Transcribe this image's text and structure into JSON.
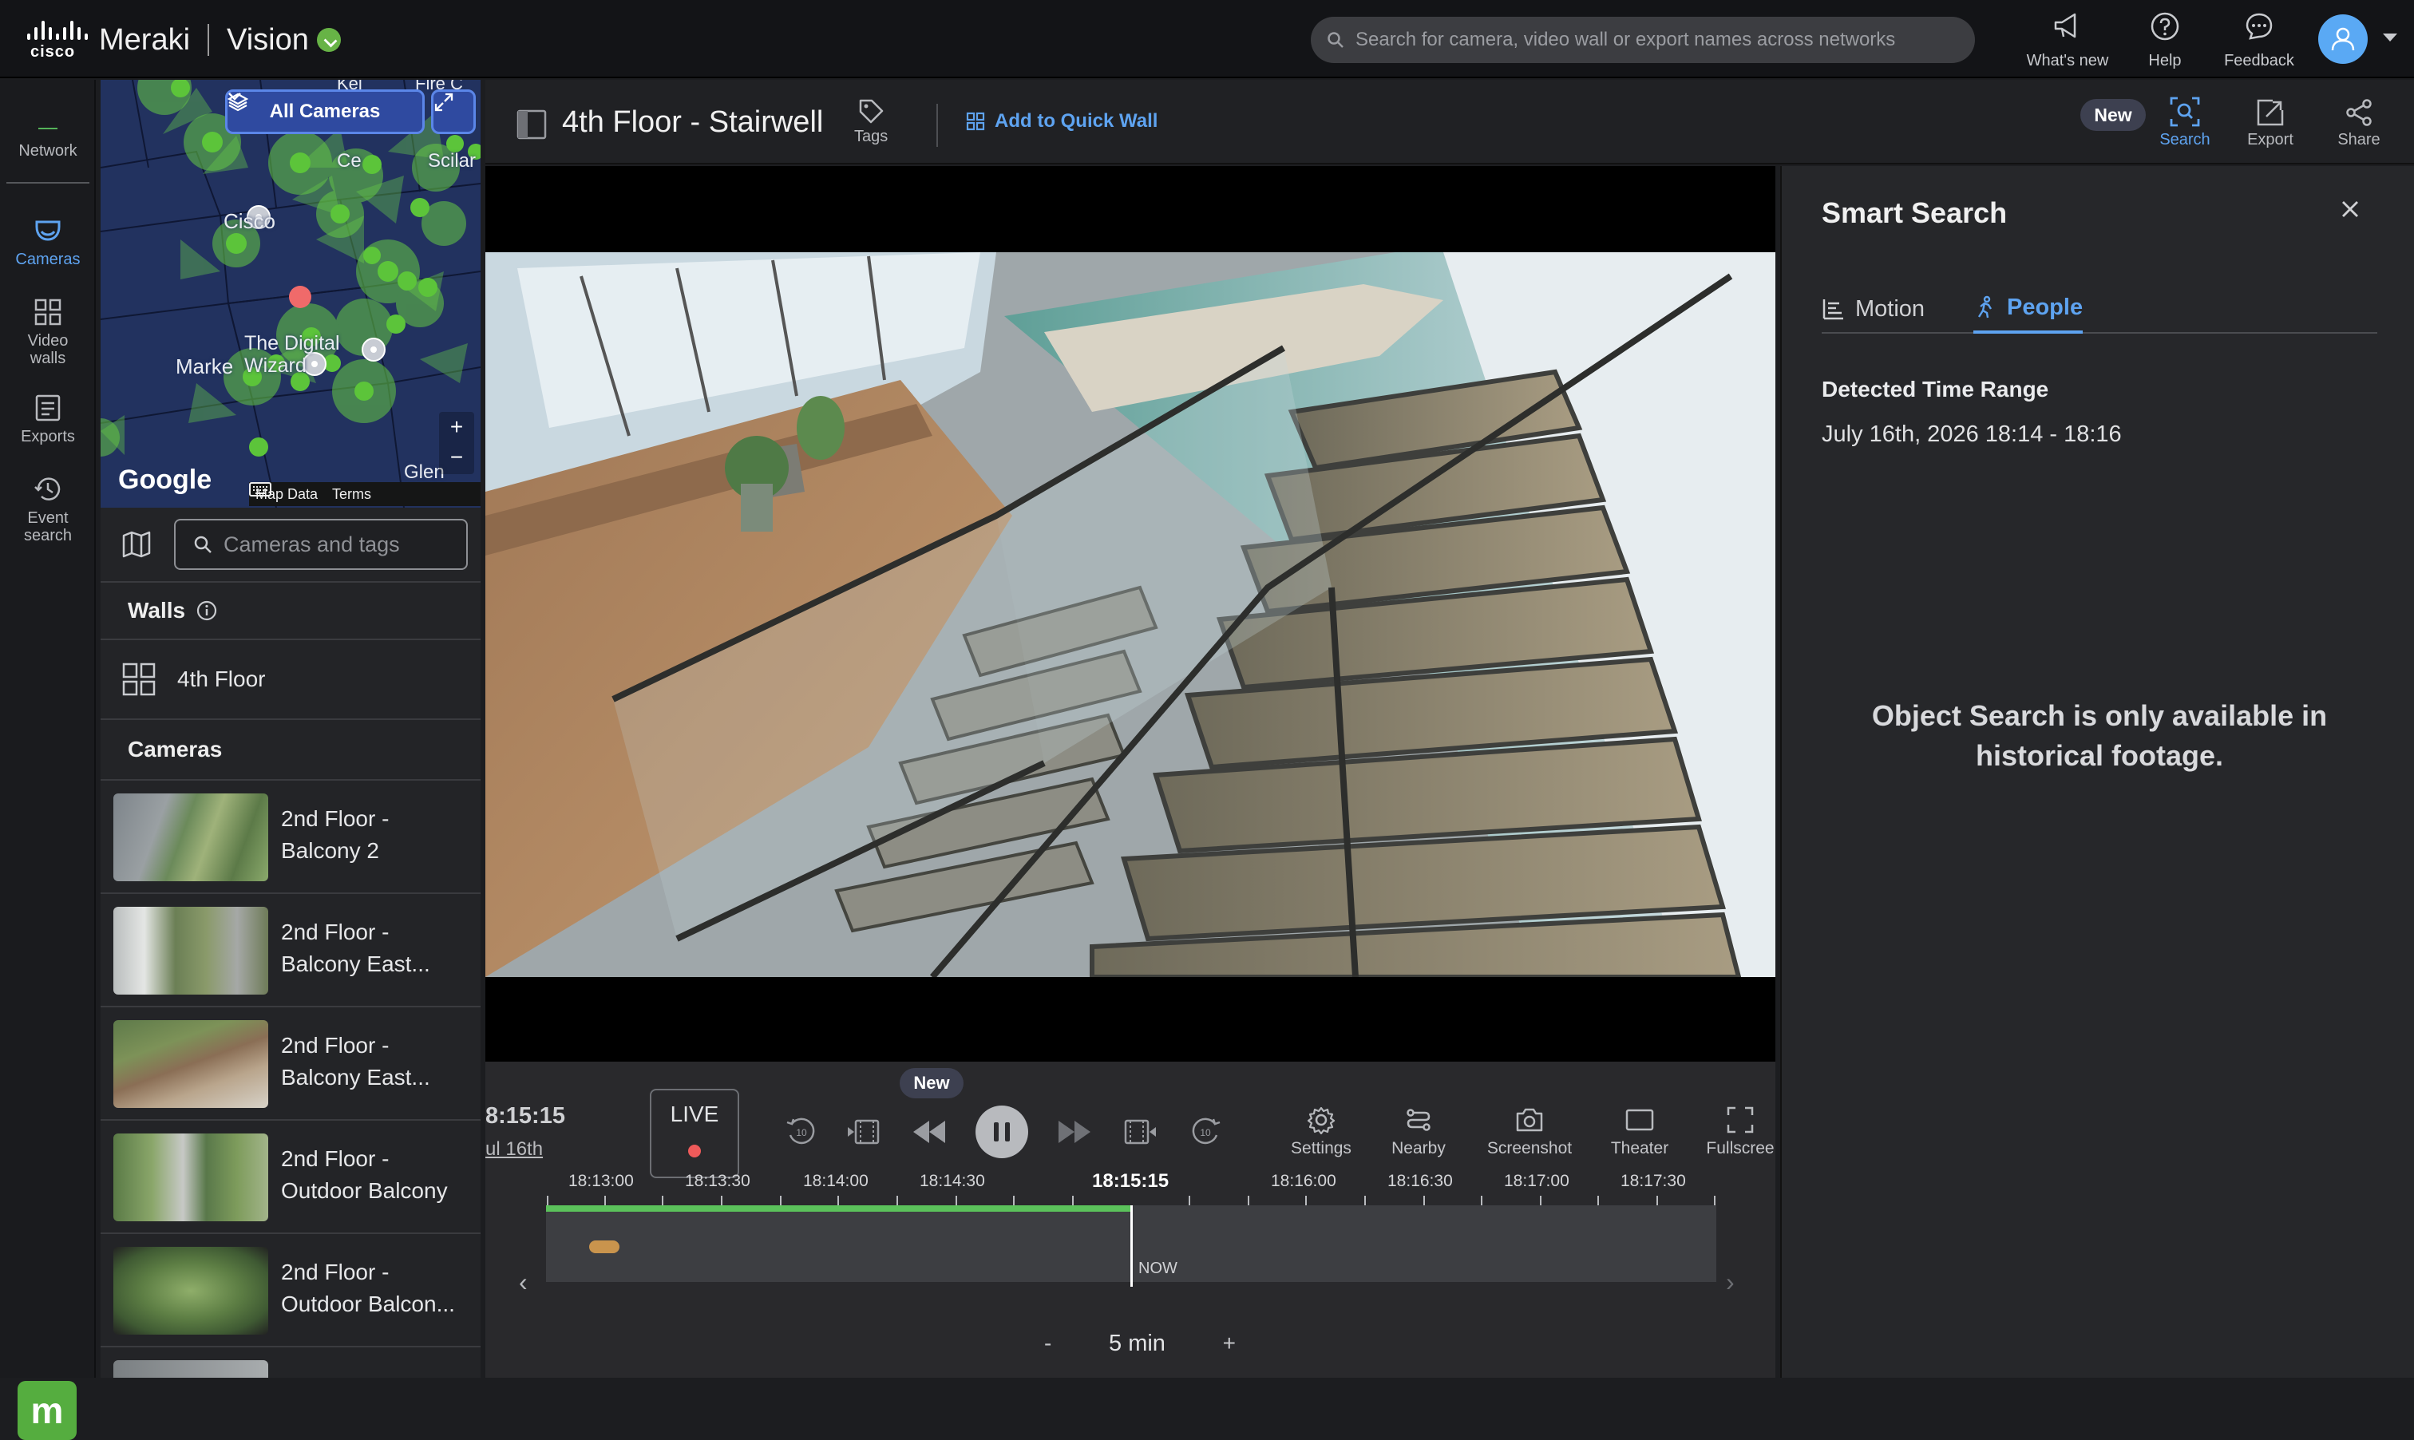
{
  "brand": {
    "company": "cisco",
    "product": "Meraki",
    "app": "Vision"
  },
  "global_search": {
    "placeholder": "Search for camera, video wall or export names across networks"
  },
  "top_actions": {
    "whats_new": "What's new",
    "help": "Help",
    "feedback": "Feedback"
  },
  "leftnav": {
    "network": "Network",
    "cameras": "Cameras",
    "video_walls": "Video walls",
    "exports": "Exports",
    "event_search": "Event search"
  },
  "map": {
    "all_cameras": "All Cameras",
    "labels": [
      "Cisco",
      "The Digital Wizard",
      "Marke",
      "Glen",
      "Kel",
      "Fire C",
      "Ce",
      "Scilar"
    ],
    "google": "Google",
    "map_data": "Map Data",
    "terms": "Terms",
    "zoom_in": "+",
    "zoom_out": "−"
  },
  "camera_search": {
    "placeholder": "Cameras and tags"
  },
  "walls": {
    "header": "Walls",
    "items": [
      "4th Floor"
    ]
  },
  "cameras": {
    "header": "Cameras",
    "items": [
      {
        "name": "2nd Floor - Balcony 2"
      },
      {
        "name": "2nd Floor - Balcony East..."
      },
      {
        "name": "2nd Floor - Balcony East..."
      },
      {
        "name": "2nd Floor - Outdoor Balcony"
      },
      {
        "name": "2nd Floor - Outdoor Balcon..."
      }
    ]
  },
  "camera_header": {
    "title": "4th Floor - Stairwell",
    "tags": "Tags",
    "add_quick_wall": "Add to Quick Wall",
    "new_badge": "New",
    "search": "Search",
    "export": "Export",
    "share": "Share"
  },
  "playback": {
    "time": "8:15:15",
    "date": "ul 16th",
    "live": "LIVE",
    "new_badge": "New",
    "settings": "Settings",
    "nearby": "Nearby",
    "screenshot": "Screenshot",
    "theater": "Theater",
    "fullscreen": "Fullscree",
    "rewind_seconds": "10",
    "forward_seconds": "10",
    "timeline": {
      "ticks": [
        "18:13:00",
        "18:13:30",
        "18:14:00",
        "18:14:30",
        "18:15:15",
        "18:16:00",
        "18:16:30",
        "18:17:00",
        "18:17:30"
      ],
      "now": "NOW",
      "played_fraction": 0.5
    },
    "zoom": {
      "minus": "-",
      "value": "5 min",
      "plus": "+"
    }
  },
  "smart_search": {
    "title": "Smart Search",
    "tabs": [
      "Motion",
      "People"
    ],
    "active_tab": "People",
    "detected_label": "Detected Time Range",
    "detected_value": "July 16th, 2026 18:14 - 18:16",
    "message": "Object Search is only available in historical footage."
  },
  "colors": {
    "accent_blue": "#5ea3f0",
    "live_red": "#ee5a5a",
    "timeline_green": "#5bc25b",
    "meraki_green": "#55ad3f"
  }
}
